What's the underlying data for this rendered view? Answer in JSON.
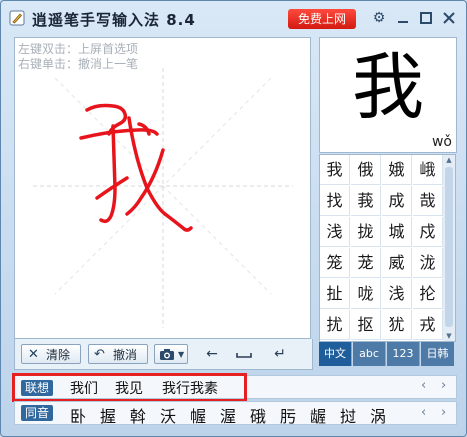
{
  "app": {
    "title": "逍遥笔手写输入法 8.4",
    "free_button": "免费上网",
    "controls": [
      "settings-icon",
      "minimize-icon",
      "maximize-icon",
      "close-icon"
    ]
  },
  "canvas": {
    "hint_line1": "左键双击：上屏首选项",
    "hint_line2": "右键单击：撤消上一笔",
    "stroke_color": "#e8141c"
  },
  "toolbar": {
    "clear_label": "清除",
    "undo_label": "撤消"
  },
  "preview": {
    "char": "我",
    "pinyin": "wǒ"
  },
  "candidates": [
    [
      "我",
      "俄",
      "娥",
      "峨"
    ],
    [
      "找",
      "莪",
      "成",
      "哉"
    ],
    [
      "浅",
      "拢",
      "城",
      "戍"
    ],
    [
      "笼",
      "茏",
      "威",
      "泷"
    ],
    [
      "扯",
      "咙",
      "浅",
      "抡"
    ],
    [
      "扰",
      "抠",
      "犹",
      "戎"
    ]
  ],
  "modes": [
    {
      "label": "中文",
      "active": true
    },
    {
      "label": "abc",
      "active": false
    },
    {
      "label": "123",
      "active": false
    },
    {
      "label": "日韩",
      "active": false
    }
  ],
  "association": {
    "tag": "联想",
    "words": [
      "我们",
      "我见",
      "我行我素"
    ]
  },
  "homophones": {
    "tag": "同音",
    "chars": [
      "卧",
      "握",
      "斡",
      "沃",
      "幄",
      "渥",
      "硪",
      "肟",
      "龌",
      "挝",
      "涡"
    ]
  },
  "colors": {
    "accent": "#1f5d9b",
    "free_button": "#e0281c",
    "highlight_box": "#e62020"
  }
}
